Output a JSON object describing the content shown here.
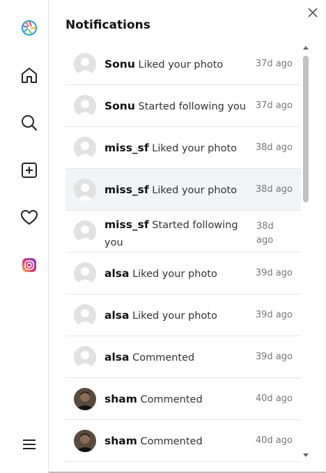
{
  "app": {
    "logo_icon": "aperture-logo-icon",
    "accent_color": "#2ea6d6"
  },
  "sidebar": {
    "items": [
      {
        "name": "home",
        "icon": "home-icon"
      },
      {
        "name": "search",
        "icon": "search-icon"
      },
      {
        "name": "create",
        "icon": "plus-square-icon"
      },
      {
        "name": "notifications",
        "icon": "heart-icon"
      },
      {
        "name": "instagram",
        "icon": "instagram-icon"
      }
    ],
    "menu_icon": "hamburger-menu-icon"
  },
  "panel": {
    "title": "Notifications",
    "close_icon": "close-icon"
  },
  "notifications": [
    {
      "user": "Sonu",
      "action": "Liked your photo",
      "time": "37d ago",
      "avatar": "default"
    },
    {
      "user": "Sonu",
      "action": "Started following you",
      "time": "37d ago",
      "avatar": "default"
    },
    {
      "user": "miss_sf",
      "action": "Liked your photo",
      "time": "38d ago",
      "avatar": "default"
    },
    {
      "user": "miss_sf",
      "action": "Liked your photo",
      "time": "38d ago",
      "avatar": "default",
      "highlighted": true
    },
    {
      "user": "miss_sf",
      "action": "Started following you",
      "time": "38d ago",
      "avatar": "default",
      "wrapped": true
    },
    {
      "user": "alsa",
      "action": "Liked your photo",
      "time": "39d ago",
      "avatar": "default"
    },
    {
      "user": "alsa",
      "action": "Liked your photo",
      "time": "39d ago",
      "avatar": "default"
    },
    {
      "user": "alsa",
      "action": "Commented",
      "time": "39d ago",
      "avatar": "default"
    },
    {
      "user": "sham",
      "action": "Commented",
      "time": "40d ago",
      "avatar": "photo"
    },
    {
      "user": "sham",
      "action": "Commented",
      "time": "40d ago",
      "avatar": "photo"
    }
  ]
}
